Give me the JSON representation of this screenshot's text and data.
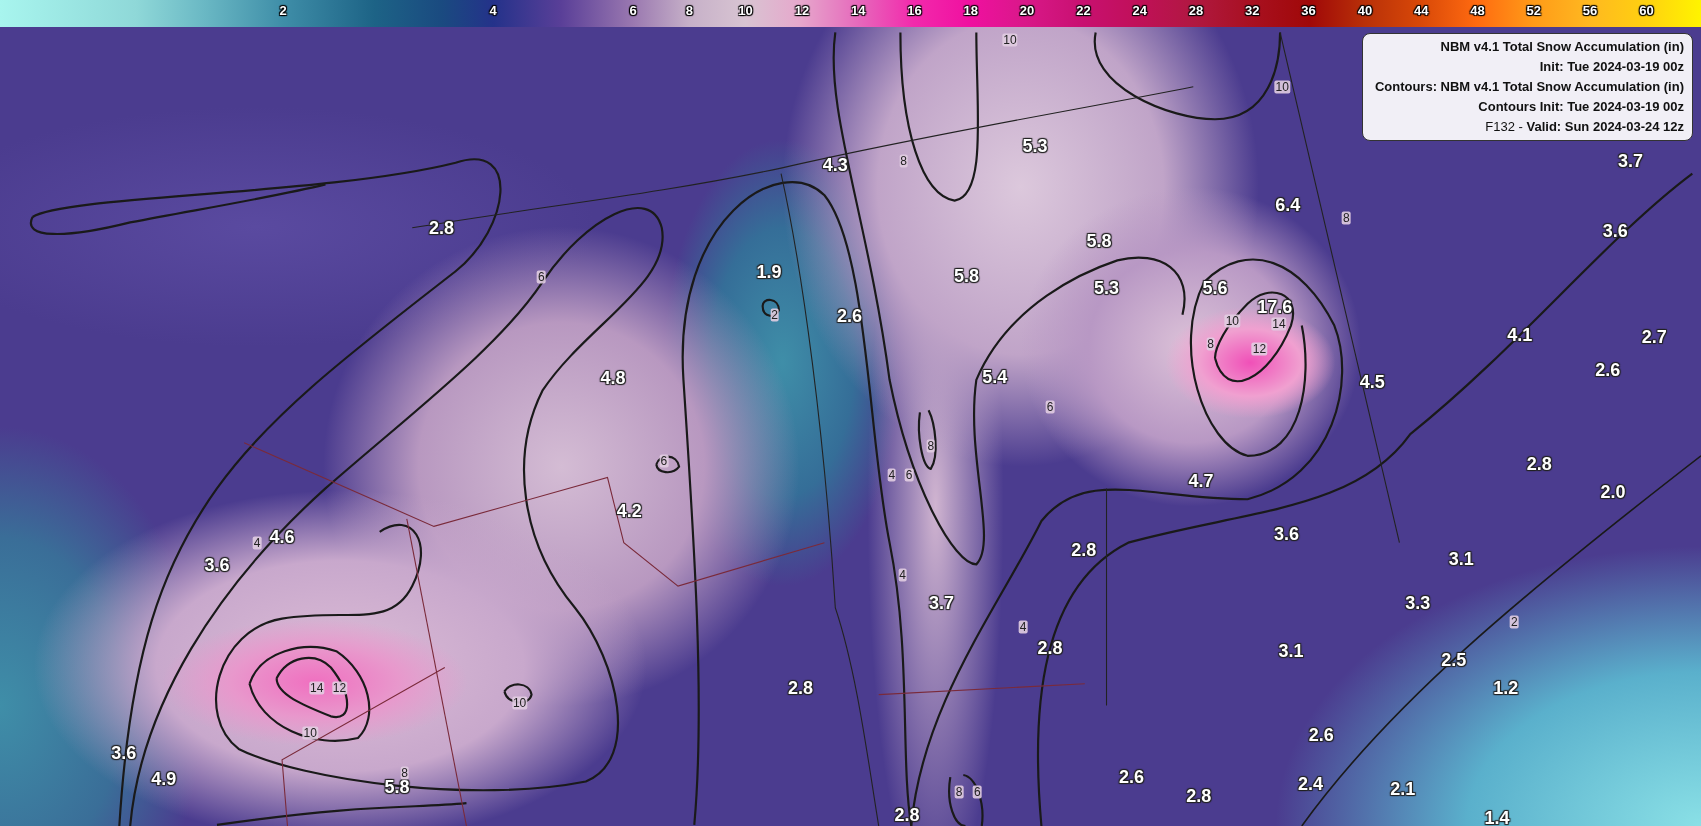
{
  "colorbar": {
    "ticks": [
      "2",
      "4",
      "6",
      "8",
      "10",
      "12",
      "14",
      "16",
      "18",
      "20",
      "22",
      "24",
      "28",
      "32",
      "36",
      "40",
      "44",
      "48",
      "52",
      "56",
      "60"
    ]
  },
  "legend": {
    "title": "NBM v4.1 Total Snow Accumulation (in)",
    "init": "Init: Tue 2024-03-19 00z",
    "contours": "Contours: NBM v4.1 Total Snow Accumulation (in)",
    "contours_init": "Contours Init: Tue 2024-03-19 00z",
    "valid": "F132 - **Valid: Sun 2024-03-24 12z**"
  },
  "map": {
    "values": [
      "4.3",
      "5.3",
      "2.8",
      "6.4",
      "3.7",
      "3.6",
      "1.9",
      "5.8",
      "2.6",
      "5.8",
      "5.3",
      "5.6",
      "17.6",
      "4.1",
      "2.7",
      "2.6",
      "4.8",
      "5.4",
      "4.5",
      "2.8",
      "2.0",
      "4.2",
      "4.7",
      "4.6",
      "3.6",
      "2.8",
      "3.6",
      "3.1",
      "3.7",
      "3.3",
      "3.1",
      "2.8",
      "2.5",
      "1.2",
      "2.8",
      "3.6",
      "4.9",
      "5.8",
      "2.6",
      "2.6",
      "2.8",
      "2.4",
      "2.1",
      "2.8",
      "1.4"
    ],
    "contour_labels": [
      "10",
      "10",
      "8",
      "8",
      "6",
      "2",
      "10",
      "14",
      "8",
      "12",
      "6",
      "8",
      "6",
      "4",
      "6",
      "4",
      "4",
      "4",
      "2",
      "14",
      "12",
      "10",
      "10",
      "8",
      "8",
      "6"
    ]
  }
}
